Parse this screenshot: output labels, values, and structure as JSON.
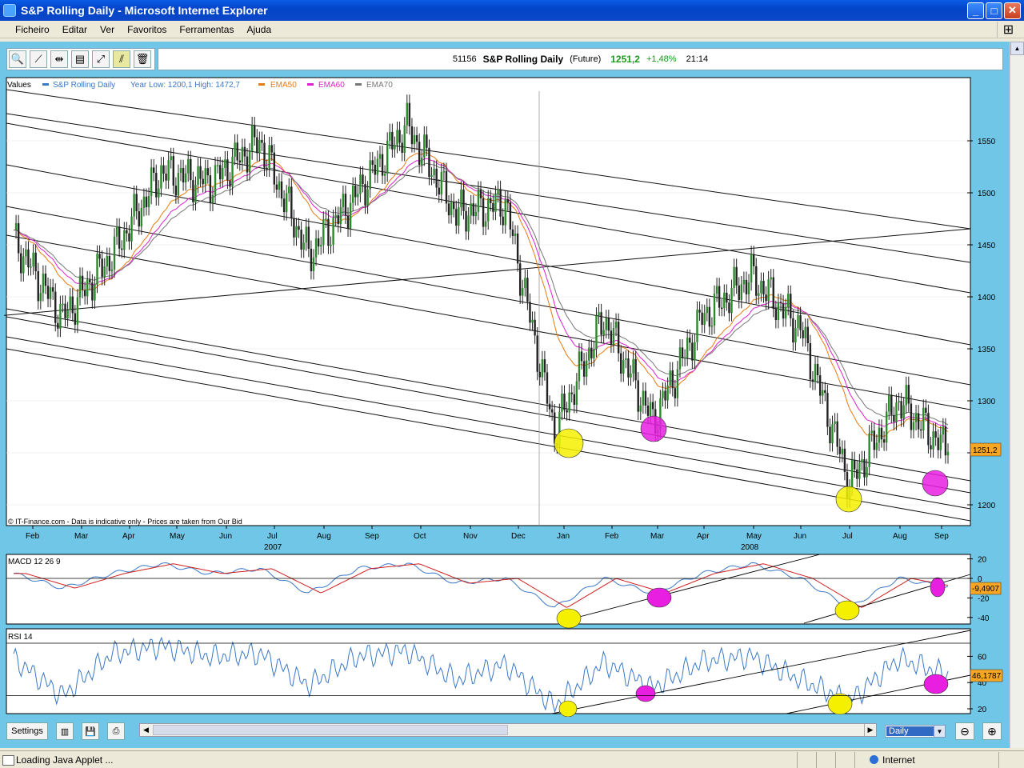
{
  "window": {
    "title": "S&P Rolling Daily - Microsoft Internet Explorer",
    "min": "_",
    "max": "□",
    "close": "✕"
  },
  "menu": [
    "Ficheiro",
    "Editar",
    "Ver",
    "Favoritos",
    "Ferramentas",
    "Ajuda"
  ],
  "info": {
    "code": "51156",
    "name": "S&P Rolling Daily",
    "type": "(Future)",
    "price": "1251,2",
    "change": "+1,48%",
    "time": "21:14",
    "price_color": "#1a9a1a"
  },
  "legend": {
    "values": "Values",
    "series": "S&P Rolling Daily",
    "range": "Year Low: 1200,1 High: 1472,7",
    "ema50": "EMA50",
    "ema60": "EMA60",
    "ema70": "EMA70",
    "colors": {
      "series": "#3a78c8",
      "ema50": "#e87a10",
      "ema60": "#e020d0",
      "ema70": "#777777"
    }
  },
  "copyright": "© IT-Finance.com - Data is indicative only - Prices are taken from Our Bid",
  "price_axis": {
    "ticks": [
      "1550",
      "1500",
      "1450",
      "1400",
      "1350",
      "1300",
      "1250",
      "1200"
    ],
    "last": "1251,2"
  },
  "months": [
    "Feb",
    "Mar",
    "Apr",
    "May",
    "Jun",
    "Jul",
    "Aug",
    "Sep",
    "Oct",
    "Nov",
    "Dec",
    "Jan",
    "Feb",
    "Mar",
    "Apr",
    "May",
    "Jun",
    "Jul",
    "Aug",
    "Sep"
  ],
  "years": [
    "2007",
    "2008"
  ],
  "macd": {
    "label": "MACD 12 26 9",
    "ticks": [
      "20",
      "0",
      "-20",
      "-40"
    ],
    "last": "-9,4907"
  },
  "rsi": {
    "label": "RSI 14",
    "ticks": [
      "60",
      "40",
      "20"
    ],
    "last": "46,1787"
  },
  "bottom": {
    "settings": "Settings",
    "period": "Daily"
  },
  "status": {
    "message": "Loading Java Applet ...",
    "zone": "Internet"
  },
  "chart_data": [
    {
      "type": "line",
      "title": "S&P Rolling Daily",
      "x": [
        "Feb 2007",
        "Mar 2007",
        "Apr 2007",
        "May 2007",
        "Jun 2007",
        "Jul 2007",
        "Aug 2007",
        "Sep 2007",
        "Oct 2007",
        "Nov 2007",
        "Dec 2007",
        "Jan 2008",
        "Feb 2008",
        "Mar 2008",
        "Apr 2008",
        "May 2008",
        "Jun 2008",
        "Jul 2008",
        "Aug 2008",
        "Sep 2008"
      ],
      "series": [
        {
          "name": "S&P Rolling Daily",
          "values": [
            1455,
            1380,
            1440,
            1520,
            1510,
            1550,
            1440,
            1500,
            1565,
            1480,
            1490,
            1270,
            1380,
            1280,
            1380,
            1420,
            1370,
            1220,
            1300,
            1251
          ]
        }
      ],
      "ylim": [
        1180,
        1600
      ]
    },
    {
      "type": "line",
      "title": "MACD 12 26 9",
      "x": [
        "Feb 2007",
        "Mar 2007",
        "Apr 2007",
        "May 2007",
        "Jun 2007",
        "Jul 2007",
        "Aug 2007",
        "Sep 2007",
        "Oct 2007",
        "Nov 2007",
        "Dec 2007",
        "Jan 2008",
        "Feb 2008",
        "Mar 2008",
        "Apr 2008",
        "May 2008",
        "Jun 2008",
        "Jul 2008",
        "Aug 2008",
        "Sep 2008"
      ],
      "series": [
        {
          "values": [
            5,
            -10,
            5,
            15,
            5,
            10,
            -15,
            10,
            15,
            -5,
            0,
            -30,
            0,
            -15,
            5,
            15,
            0,
            -30,
            0,
            -9.5
          ]
        }
      ],
      "ylim": [
        -45,
        20
      ]
    },
    {
      "type": "line",
      "title": "RSI 14",
      "x": [
        "Feb 2007",
        "Mar 2007",
        "Apr 2007",
        "May 2007",
        "Jun 2007",
        "Jul 2007",
        "Aug 2007",
        "Sep 2007",
        "Oct 2007",
        "Nov 2007",
        "Dec 2007",
        "Jan 2008",
        "Feb 2008",
        "Mar 2008",
        "Apr 2008",
        "May 2008",
        "Jun 2008",
        "Jul 2008",
        "Aug 2008",
        "Sep 2008"
      ],
      "series": [
        {
          "values": [
            58,
            30,
            62,
            68,
            60,
            62,
            38,
            60,
            64,
            42,
            54,
            22,
            55,
            36,
            56,
            60,
            42,
            26,
            58,
            46
          ]
        }
      ],
      "ylim": [
        15,
        75
      ]
    }
  ]
}
